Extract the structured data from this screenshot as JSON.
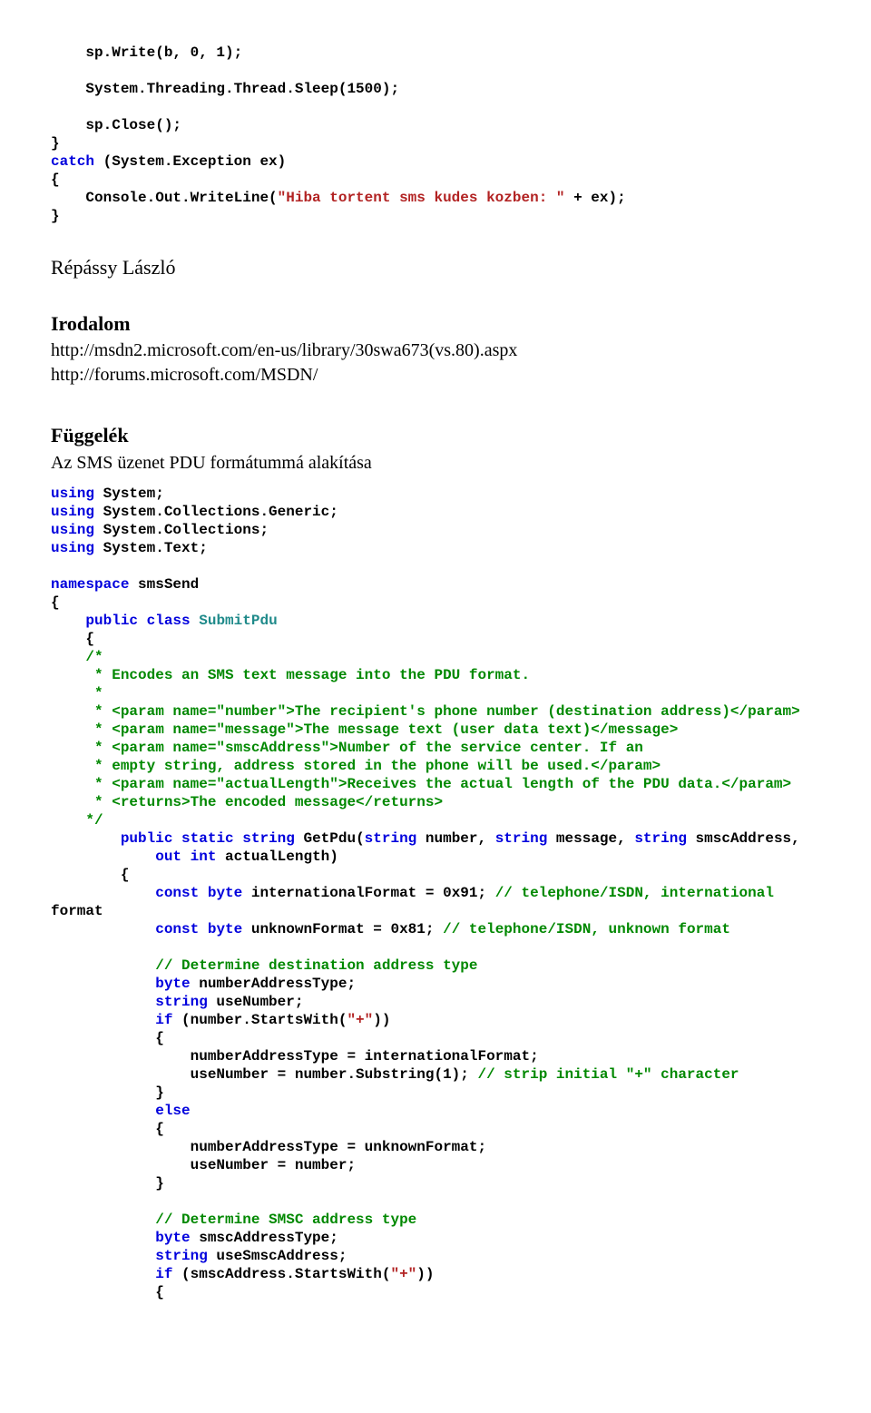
{
  "code1": {
    "l1": "    sp.Write(b, 0, 1);",
    "l2": "    System.Threading.Thread.Sleep(1500);",
    "l3": "    sp.Close();",
    "l4": "}",
    "l5": "catch",
    "l6": " (System.Exception ex)",
    "l7": "{",
    "l8": "    Console.Out.WriteLine(",
    "l9": "\"Hiba tortent sms kudes kozben: \"",
    "l10": " + ex);",
    "l11": "}"
  },
  "author": "Répássy László",
  "irodalom": {
    "title": "Irodalom",
    "link1": "http://msdn2.microsoft.com/en-us/library/30swa673(vs.80).aspx",
    "link2": "http://forums.microsoft.com/MSDN/"
  },
  "fuggelek": {
    "title": "Függelék",
    "sub": "Az SMS üzenet PDU formátummá alakítása"
  },
  "code2": {
    "u1_kw": "using",
    "u1_rest": " System;",
    "u2_kw": "using",
    "u2_rest": " System.Collections.Generic;",
    "u3_kw": "using",
    "u3_rest": " System.Collections;",
    "u4_kw": "using",
    "u4_rest": " System.Text;",
    "ns_kw": "namespace",
    "ns_rest": " smsSend",
    "open_brace": "{",
    "cls1": "    ",
    "cls_kw1": "public",
    "cls_sp1": " ",
    "cls_kw2": "class",
    "cls_sp2": " ",
    "cls_type": "SubmitPdu",
    "cls_open": "    {",
    "cmt_open": "    /*",
    "cmt_l1": "     * Encodes an SMS text message into the PDU format.",
    "cmt_l2": "     *",
    "cmt_l3": "     * <param name=\"number\">The recipient's phone number (destination address)</param>",
    "cmt_l4": "     * <param name=\"message\">The message text (user data text)</message>",
    "cmt_l5": "     * <param name=\"smscAddress\">Number of the service center. If an",
    "cmt_l6": "     * empty string, address stored in the phone will be used.</param>",
    "cmt_l7": "     * <param name=\"actualLength\">Receives the actual length of the PDU data.</param>",
    "cmt_l8": "     * <returns>The encoded message</returns>",
    "cmt_close": "    */",
    "fn_indent": "        ",
    "fn_kw1": "public",
    "fn_sp1": " ",
    "fn_kw2": "static",
    "fn_sp2": " ",
    "fn_kw3": "string",
    "fn_name": " GetPdu(",
    "fn_kw4": "string",
    "fn_p1": " number, ",
    "fn_kw5": "string",
    "fn_p2": " message, ",
    "fn_kw6": "string",
    "fn_p3": " smscAddress,",
    "fn2_indent": "            ",
    "fn2_kw1": "out",
    "fn2_sp": " ",
    "fn2_kw2": "int",
    "fn2_rest": " actualLength)",
    "fn_open": "        {",
    "c1_indent": "            ",
    "c1_kw1": "const",
    "c1_sp1": " ",
    "c1_kw2": "byte",
    "c1_rest": " internationalFormat = 0x91; ",
    "c1_cmt": "// telephone/ISDN, international ",
    "c1_word": "format",
    "c2_indent": "            ",
    "c2_kw1": "const",
    "c2_sp1": " ",
    "c2_kw2": "byte",
    "c2_rest": " unknownFormat = 0x81; ",
    "c2_cmt": "// telephone/ISDN, unknown format",
    "cm3_indent": "            ",
    "cm3": "// Determine destination address type",
    "d1": "            ",
    "d1_kw": "byte",
    "d1_rest": " numberAddressType;",
    "d2": "            ",
    "d2_kw": "string",
    "d2_rest": " useNumber;",
    "if1": "            ",
    "if1_kw": "if",
    "if1_rest": " (number.StartsWith(",
    "if1_str": "\"+\"",
    "if1_close": "))",
    "if1_open": "            {",
    "b1": "                numberAddressType = internationalFormat;",
    "b2": "                useNumber = number.Substring(1); ",
    "b2_cmt": "// strip initial \"+\" character",
    "if1_closebrace": "            }",
    "else": "            ",
    "else_kw": "else",
    "else_open": "            {",
    "b3": "                numberAddressType = unknownFormat;",
    "b4": "                useNumber = number;",
    "else_close": "            }",
    "cm4_indent": "            ",
    "cm4": "// Determine SMSC address type",
    "e1": "            ",
    "e1_kw": "byte",
    "e1_rest": " smscAddressType;",
    "e2": "            ",
    "e2_kw": "string",
    "e2_rest": " useSmscAddress;",
    "if2": "            ",
    "if2_kw": "if",
    "if2_rest": " (smscAddress.StartsWith(",
    "if2_str": "\"+\"",
    "if2_close": "))",
    "if2_open": "            {"
  }
}
